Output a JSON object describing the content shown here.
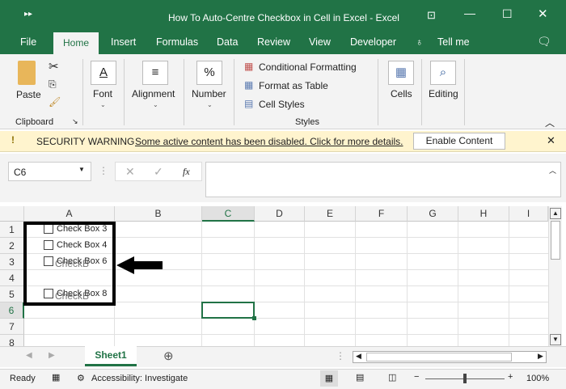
{
  "title_bar": {
    "title": "How To Auto-Centre Checkbox in Cell in Excel  -  Excel"
  },
  "tabs": [
    "File",
    "Home",
    "Insert",
    "Formulas",
    "Data",
    "Review",
    "View",
    "Developer",
    "Tell me"
  ],
  "ribbon": {
    "paste": "Paste",
    "clipboard": "Clipboard",
    "font": "Font",
    "alignment": "Alignment",
    "number": "Number",
    "conditional_formatting": "Conditional Formatting",
    "format_as_table": "Format as Table",
    "cell_styles": "Cell Styles",
    "styles": "Styles",
    "cells": "Cells",
    "editing": "Editing"
  },
  "security": {
    "label": "SECURITY WARNING",
    "message": "Some active content has been disabled. Click for more details.",
    "button": "Enable Content"
  },
  "formula_bar": {
    "name_box": "C6",
    "fx": "fx",
    "value": ""
  },
  "columns": [
    "A",
    "B",
    "C",
    "D",
    "E",
    "F",
    "G",
    "H",
    "I"
  ],
  "rows": [
    "1",
    "2",
    "3",
    "4",
    "5",
    "6",
    "7",
    "8"
  ],
  "checkboxes": [
    {
      "label": "Check Box 3",
      "row": 1
    },
    {
      "label": "Check Box 4",
      "row": 2
    },
    {
      "label": "Check Box 6",
      "row": 3,
      "overlap": "CheckB"
    },
    {
      "label": "Check Box 8",
      "row": 5,
      "overlap": "CheckB"
    }
  ],
  "selected_cell": "C6",
  "sheets": [
    "Sheet1"
  ],
  "status": {
    "ready": "Ready",
    "accessibility": "Accessibility: Investigate",
    "zoom": "100%"
  }
}
